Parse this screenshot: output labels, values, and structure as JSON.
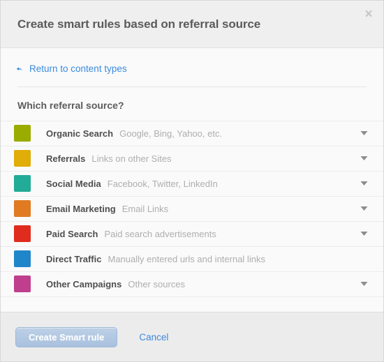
{
  "dialog": {
    "title": "Create smart rules based on referral source",
    "close_icon": "close-icon",
    "close_label": "×"
  },
  "body": {
    "back_link": {
      "label": "Return to content types",
      "icon": "back-arrow-icon"
    },
    "section_title": "Which referral source?"
  },
  "sources": [
    {
      "name": "Organic Search",
      "description": "Google, Bing, Yahoo, etc.",
      "color": "#9aac00",
      "has_chevron": true
    },
    {
      "name": "Referrals",
      "description": "Links on other Sites",
      "color": "#e0ad09",
      "has_chevron": true
    },
    {
      "name": "Social Media",
      "description": "Facebook, Twitter, LinkedIn",
      "color": "#22ab97",
      "has_chevron": true
    },
    {
      "name": "Email Marketing",
      "description": "Email Links",
      "color": "#e07b22",
      "has_chevron": true
    },
    {
      "name": "Paid Search",
      "description": "Paid search advertisements",
      "color": "#e02b1f",
      "has_chevron": true
    },
    {
      "name": "Direct Traffic",
      "description": "Manually entered urls and internal links",
      "color": "#1f86ca",
      "has_chevron": false
    },
    {
      "name": "Other Campaigns",
      "description": "Other sources",
      "color": "#bf3e8e",
      "has_chevron": true
    }
  ],
  "footer": {
    "submit_label": "Create Smart rule",
    "cancel_label": "Cancel"
  },
  "colors": {
    "link": "#3b8ade",
    "header_bg": "#efeff0",
    "footer_bg": "#ececec"
  }
}
